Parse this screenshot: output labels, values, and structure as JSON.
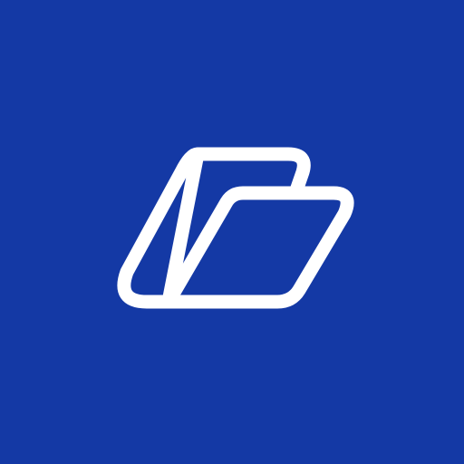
{
  "icon": {
    "name": "folder-icon",
    "background_color": "#1439A5",
    "stroke_color": "#FFFFFF"
  }
}
